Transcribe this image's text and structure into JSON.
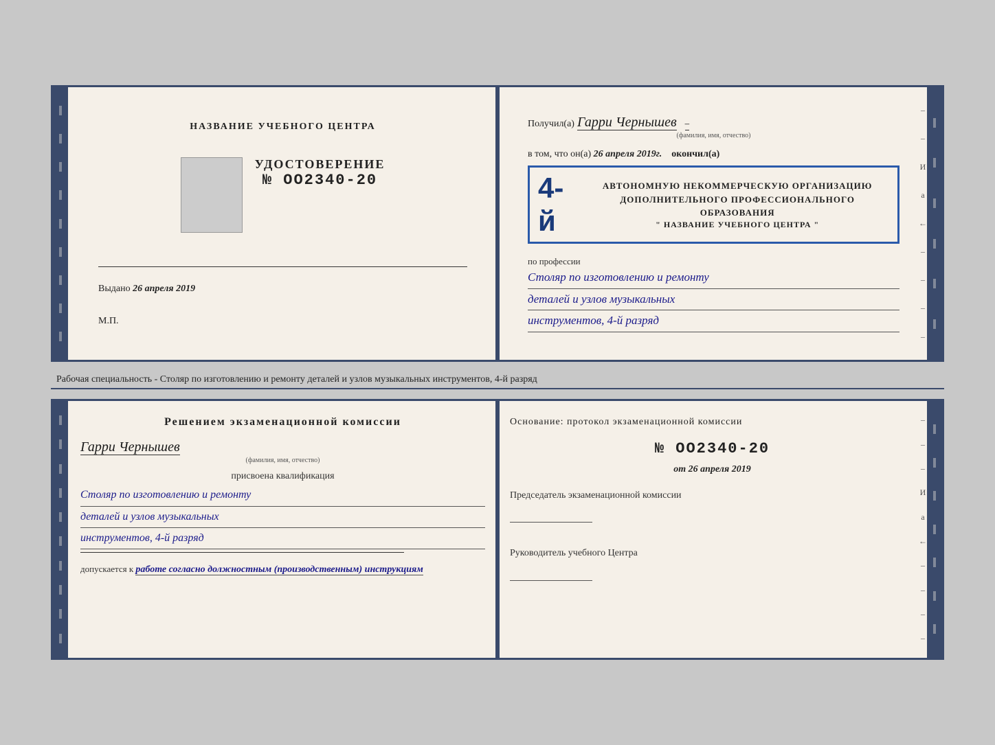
{
  "top_book": {
    "left": {
      "center_title": "НАЗВАНИЕ УЧЕБНОГО ЦЕНТРА",
      "cert_title": "УДОСТОВЕРЕНИЕ",
      "cert_number": "№ OO2340-20",
      "issued_label": "Выдано",
      "issued_date": "26 апреля 2019",
      "mp_label": "М.П."
    },
    "right": {
      "recipient_prefix": "Получил(а)",
      "recipient_name": "Гарри Чернышев",
      "recipient_hint": "(фамилия, имя, отчество)",
      "in_that_prefix": "в том, что он(а)",
      "in_that_date": "26 апреля 2019г.",
      "finished_label": "окончил(а)",
      "year_big": "4-й",
      "org_line1": "АВТОНОМНУЮ НЕКОММЕРЧЕСКУЮ ОРГАНИЗАЦИЮ",
      "org_line2": "ДОПОЛНИТЕЛЬНОГО ПРОФЕССИОНАЛЬНОГО ОБРАЗОВАНИЯ",
      "org_line3": "\" НАЗВАНИЕ УЧЕБНОГО ЦЕНТРА \"",
      "profession_label": "по профессии",
      "profession_line1": "Столяр по изготовлению и ремонту",
      "profession_line2": "деталей и узлов музыкальных",
      "profession_line3": "инструментов, 4-й разряд"
    }
  },
  "description": "Рабочая специальность - Столяр по изготовлению и ремонту деталей и узлов музыкальных инструментов, 4-й разряд",
  "bottom_book": {
    "left": {
      "decision_title": "Решением экзаменационной комиссии",
      "person_name": "Гарри Чернышев",
      "person_hint": "(фамилия, имя, отчество)",
      "assigned_label": "присвоена квалификация",
      "qual_line1": "Столяр по изготовлению и ремонту",
      "qual_line2": "деталей и узлов музыкальных",
      "qual_line3": "инструментов, 4-й разряд",
      "allowed_prefix": "допускается к",
      "allowed_italic": "работе согласно должностным (производственным) инструкциям"
    },
    "right": {
      "basis_label": "Основание: протокол экзаменационной комиссии",
      "protocol_number": "№ OO2340-20",
      "protocol_date_prefix": "от",
      "protocol_date": "26 апреля 2019",
      "chairman_label": "Председатель экзаменационной комиссии",
      "head_label": "Руководитель учебного Центра"
    }
  },
  "side_labels": {
    "И": "И",
    "а": "а",
    "arrow": "←",
    "dashes": [
      "–",
      "–",
      "–",
      "–",
      "–",
      "–",
      "–",
      "–",
      "–"
    ]
  }
}
